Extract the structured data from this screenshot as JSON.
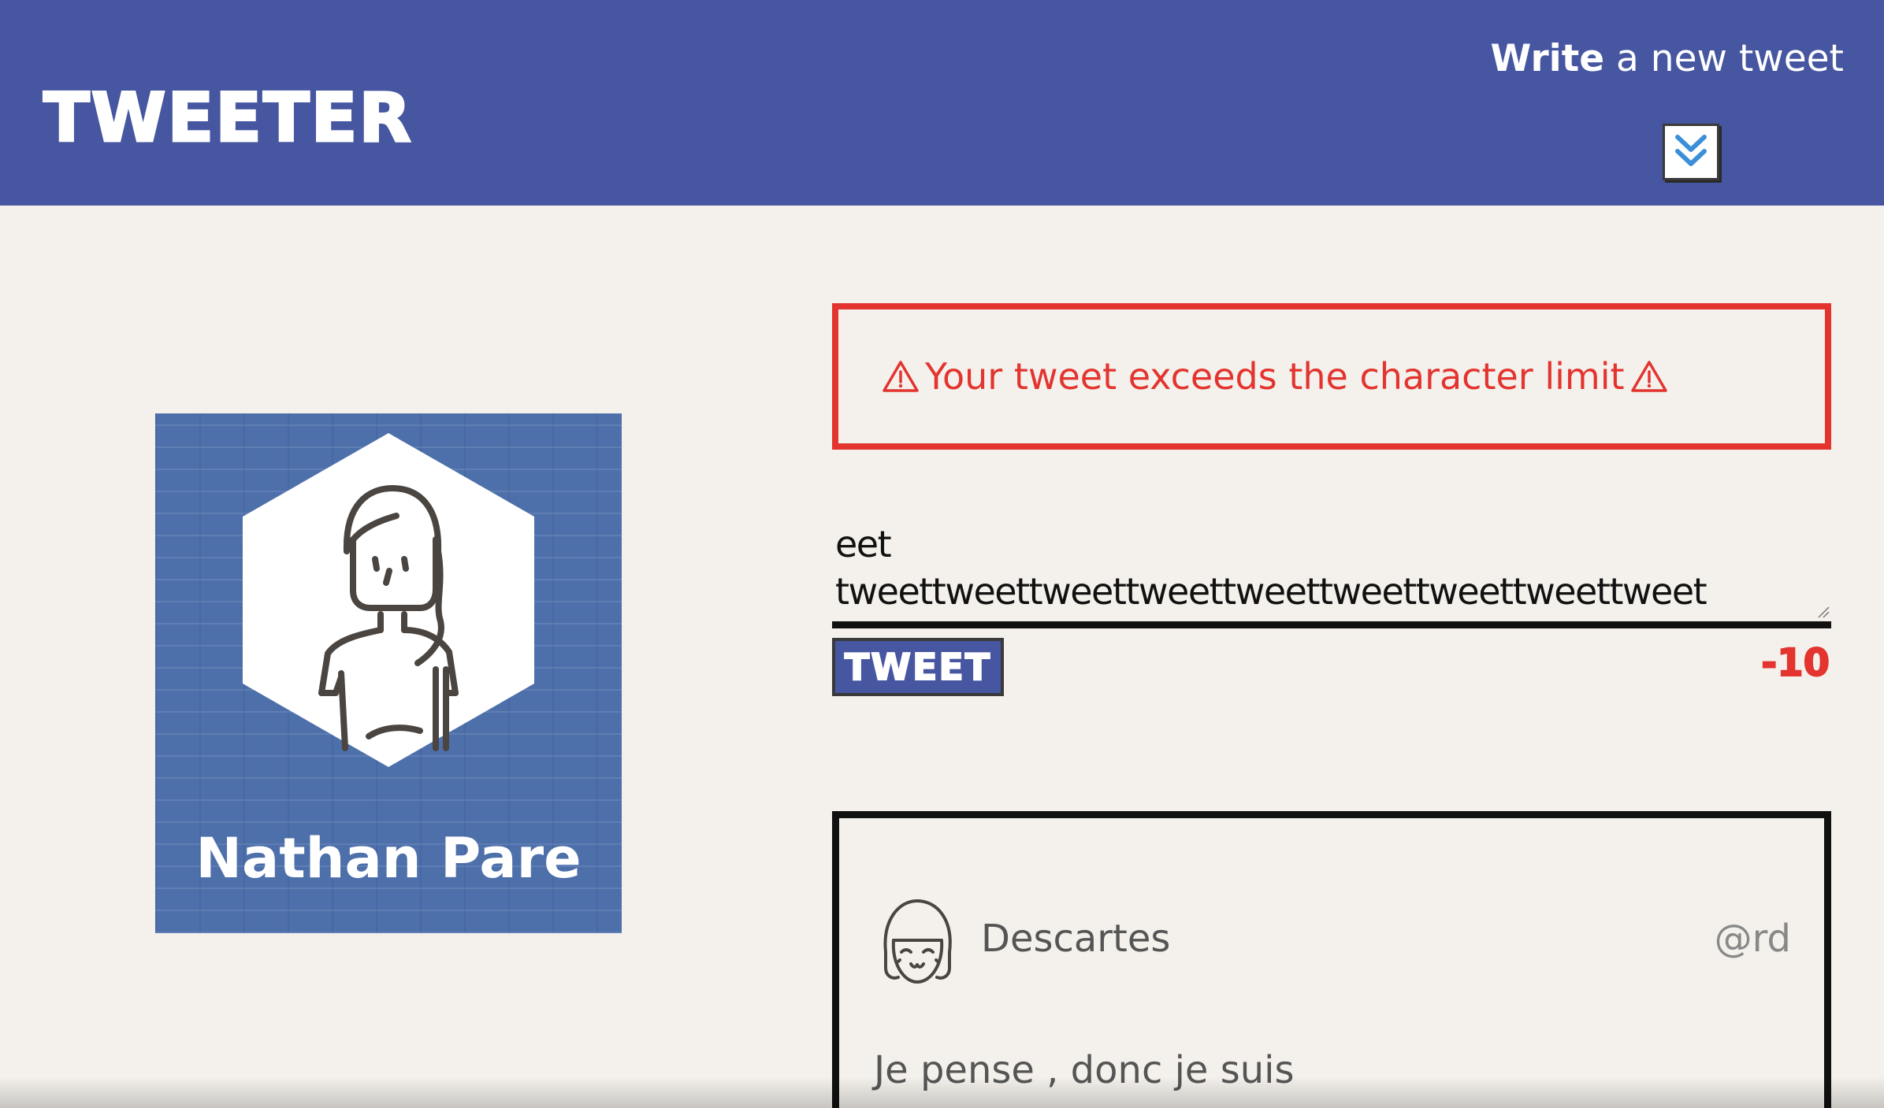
{
  "nav": {
    "brand": "TWEETER",
    "write_bold": "Write",
    "write_rest": " a new tweet",
    "toggle_icon": "double-chevron-down-icon"
  },
  "profile": {
    "name": "Nathan Pare",
    "avatar_icon": "user-avatar-icon"
  },
  "composer": {
    "error_message": "Your tweet exceeds the character limit",
    "warning_icon": "⚠",
    "text_line_1": "eettweettweettweettweettweettweettweettweettweettweet",
    "text_line_2": "tweettweettweettweettweettweettweettweettweet",
    "button_label": "TWEET",
    "counter": "-10"
  },
  "tweet": {
    "name": "Descartes",
    "handle": "@rd",
    "content": "Je pense , donc je suis"
  },
  "colors": {
    "nav": "#4656a0",
    "background": "#f4f1ec",
    "error": "#e3342f",
    "profile": "#4d6faa"
  }
}
